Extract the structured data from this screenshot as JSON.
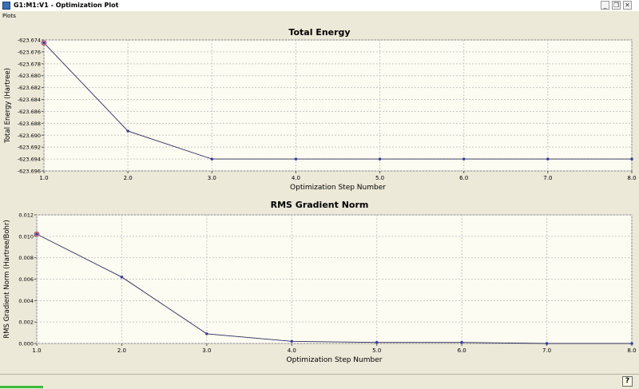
{
  "window": {
    "title": "G1:M1:V1 - Optimization Plot",
    "minimize": "_",
    "restore": "❐",
    "close": "✕"
  },
  "menu": {
    "plots": "Plots"
  },
  "status": {
    "help_icon": "?"
  },
  "chart_data": [
    {
      "type": "line",
      "title": "Total Energy",
      "xlabel": "Optimization Step Number",
      "ylabel": "Total Energy (Hartree)",
      "x": [
        1,
        2,
        3,
        4,
        5,
        6,
        7,
        8
      ],
      "y": [
        -623.6745,
        -623.6893,
        -623.694,
        -623.694,
        -623.694,
        -623.694,
        -623.694,
        -623.694
      ],
      "xlim": [
        1,
        8
      ],
      "ylim": [
        -623.696,
        -623.674
      ],
      "xticks": [
        "1.0",
        "2.0",
        "3.0",
        "4.0",
        "5.0",
        "6.0",
        "7.0",
        "8.0"
      ],
      "yticks": [
        "-623.674",
        "-623.676",
        "-623.678",
        "-623.680",
        "-623.682",
        "-623.684",
        "-623.686",
        "-623.688",
        "-623.690",
        "-623.692",
        "-623.694",
        "-623.696"
      ],
      "grid": true
    },
    {
      "type": "line",
      "title": "RMS Gradient Norm",
      "xlabel": "Optimization Step Number",
      "ylabel": "RMS Gradient Norm (Hartree/Bohr)",
      "x": [
        1,
        2,
        3,
        4,
        5,
        6,
        7,
        8
      ],
      "y": [
        0.0102,
        0.0062,
        0.0009,
        0.0002,
        0.0001,
        0.0001,
        0.0,
        0.0
      ],
      "xlim": [
        1,
        8
      ],
      "ylim": [
        0,
        0.012
      ],
      "xticks": [
        "1.0",
        "2.0",
        "3.0",
        "4.0",
        "5.0",
        "6.0",
        "7.0",
        "8.0"
      ],
      "yticks": [
        "0.012",
        "0.010",
        "0.008",
        "0.006",
        "0.004",
        "0.002",
        "0.000"
      ],
      "grid": true
    }
  ]
}
